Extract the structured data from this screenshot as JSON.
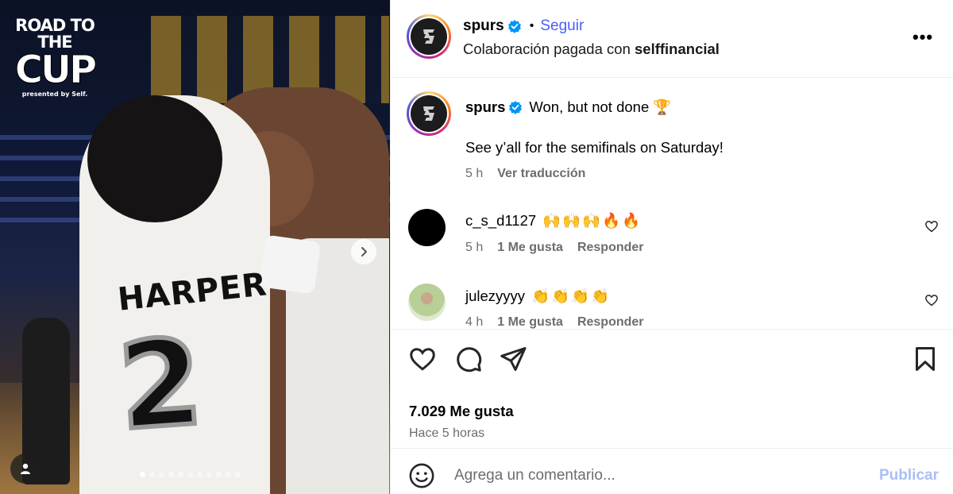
{
  "media": {
    "logo_line1": "ROAD TO THE",
    "logo_line2": "CUP",
    "logo_presented": "presented by Self.",
    "jersey_name": "HARPER",
    "jersey_number": "2",
    "carousel_dots": 11,
    "carousel_active_index": 0
  },
  "header": {
    "username": "spurs",
    "follow_label": "Seguir",
    "separator": "•",
    "subtitle_prefix": "Colaboración pagada con",
    "subtitle_partner": "selffinancial",
    "more_label": "•••"
  },
  "caption": {
    "username": "spurs",
    "line1": "Won, but not done 🏆",
    "line2": "See y’all for the semifinals on Saturday!",
    "time": "5 h",
    "translate_label": "Ver traducción"
  },
  "comments": [
    {
      "username": "c_s_d1127",
      "text": "🙌🙌🙌🔥🔥",
      "time": "5 h",
      "likes": "1 Me gusta",
      "reply_label": "Responder",
      "avatar_color": "#000000"
    },
    {
      "username": "julezyyyy",
      "text": "👏👏👏👏",
      "time": "4 h",
      "likes": "1 Me gusta",
      "reply_label": "Responder",
      "avatar_color": "#c8d6a8"
    }
  ],
  "stats": {
    "likes": "7.029 Me gusta",
    "time_ago": "Hace 5 horas"
  },
  "comment_box": {
    "placeholder": "Agrega un comentario...",
    "publish_label": "Publicar"
  },
  "colors": {
    "link_blue": "#4a5df9",
    "publish_disabled": "#a9bff7",
    "muted_text": "#6d6d6d",
    "verified": "#0095f6"
  },
  "icons": [
    "verified-badge-icon",
    "more-options-icon",
    "heart-icon",
    "comment-icon",
    "share-icon",
    "bookmark-icon",
    "emoji-icon",
    "chevron-right-icon",
    "user-tag-icon"
  ]
}
